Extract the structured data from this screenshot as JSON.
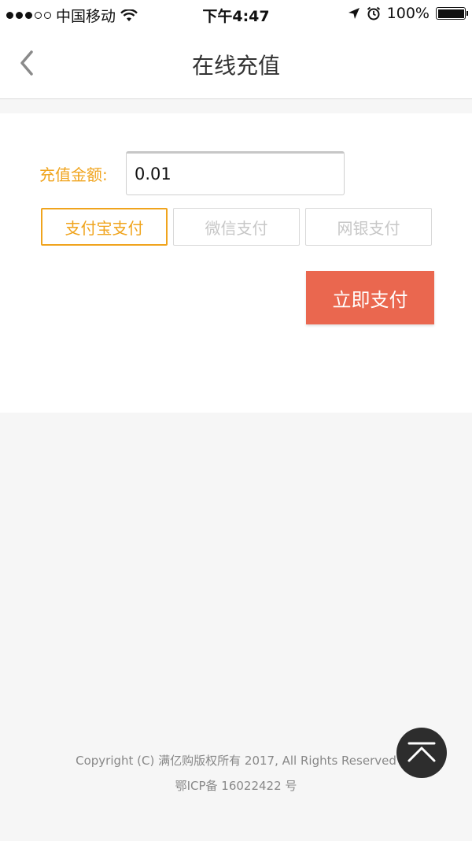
{
  "status_bar": {
    "carrier": "中国移动",
    "time": "下午4:47",
    "battery": "100%",
    "battery_level": 1.0
  },
  "nav": {
    "title": "在线充值"
  },
  "form": {
    "amount_label": "充值金额:",
    "amount_value": "0.01",
    "pay_methods": [
      {
        "label": "支付宝支付",
        "active": true
      },
      {
        "label": "微信支付",
        "active": false
      },
      {
        "label": "网银支付",
        "active": false
      }
    ],
    "pay_now_label": "立即支付"
  },
  "footer": {
    "copyright": "Copyright (C) 满亿购版权所有 2017, All Rights Reserved",
    "icp": "鄂ICP备 16022422 号"
  },
  "colors": {
    "accent": "#f0a41d",
    "pay_button": "#ea674f",
    "scroll_top_bg": "#2d2d2d"
  },
  "icons": {
    "back": "chevron-left-icon",
    "wifi": "wifi-icon",
    "location": "location-arrow-icon",
    "alarm": "alarm-icon",
    "battery": "battery-icon",
    "scroll_top": "scroll-to-top-icon"
  }
}
